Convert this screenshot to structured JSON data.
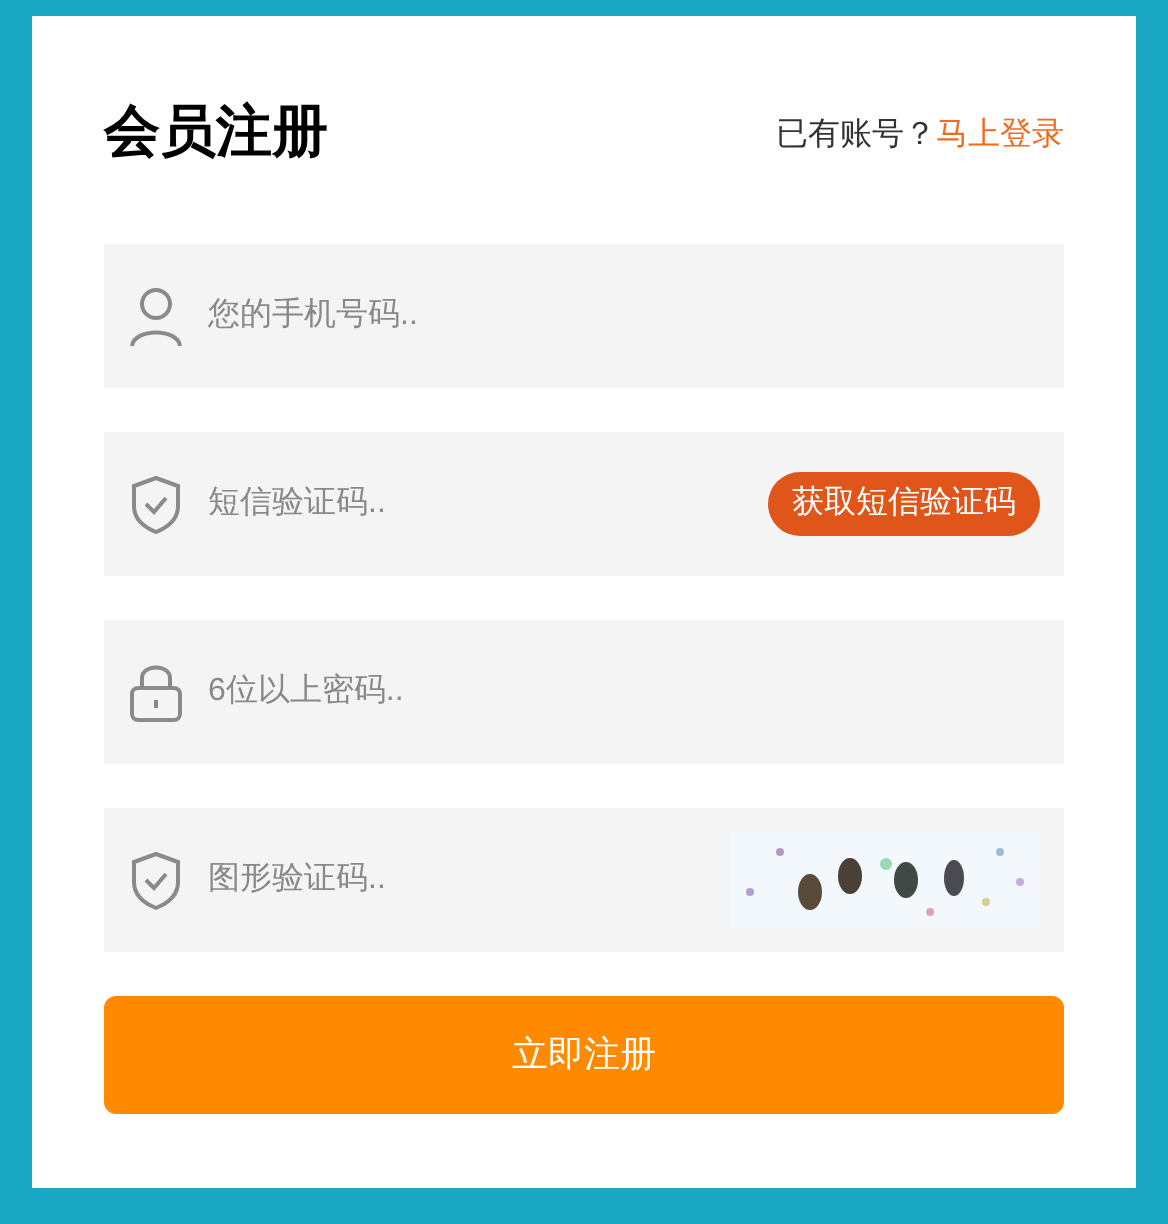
{
  "title": "会员注册",
  "login_prompt": {
    "text": "已有账号？",
    "link": "马上登录"
  },
  "fields": [
    {
      "kind": "phone",
      "placeholder": "您的手机号码.."
    },
    {
      "kind": "sms",
      "placeholder": "短信验证码..",
      "action": {
        "kind": "button",
        "label": "获取短信验证码"
      }
    },
    {
      "kind": "password",
      "placeholder": "6位以上密码.."
    },
    {
      "kind": "captcha",
      "placeholder": "图形验证码.."
    }
  ],
  "submit": "立即注册"
}
